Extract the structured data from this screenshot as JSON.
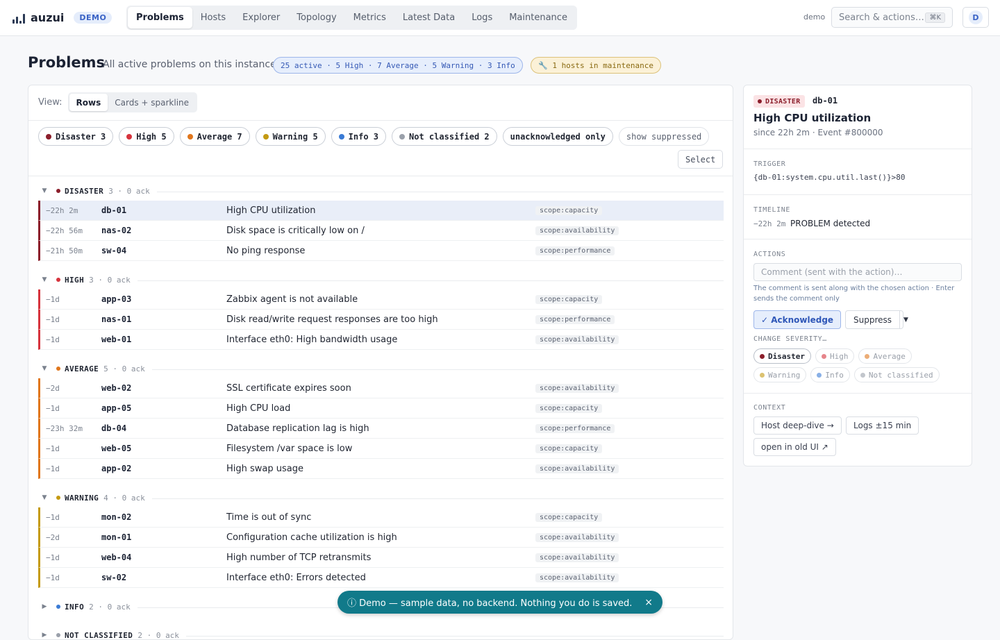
{
  "app": {
    "name": "auzui",
    "badge": "DEMO",
    "user": "demo",
    "avatar": "D"
  },
  "nav": {
    "items": [
      "Problems",
      "Hosts",
      "Explorer",
      "Topology",
      "Metrics",
      "Latest Data",
      "Logs",
      "Maintenance"
    ],
    "active": 0
  },
  "search": {
    "placeholder": "Search & actions…",
    "shortcut": "⌘K"
  },
  "page": {
    "title": "Problems",
    "subtitle": "All active problems on this instance",
    "summary": "25 active · 5 High · 7 Average · 5 Warning · 3 Info",
    "maintenance": "🔧 1 hosts in maintenance"
  },
  "view": {
    "label": "View:",
    "options": [
      "Rows",
      "Cards + sparkline"
    ],
    "active": 0
  },
  "filters": {
    "severity": [
      {
        "label": "Disaster 3",
        "color": "#8b1e2b"
      },
      {
        "label": "High 5",
        "color": "#d6333d"
      },
      {
        "label": "Average 7",
        "color": "#e0761c"
      },
      {
        "label": "Warning 5",
        "color": "#c49a12"
      },
      {
        "label": "Info 3",
        "color": "#3a7bd5"
      },
      {
        "label": "Not classified 2",
        "color": "#9aa0aa"
      }
    ],
    "unack": "unacknowledged only",
    "suppressed": "show suppressed",
    "select": "Select"
  },
  "groups": [
    {
      "name": "DISASTER",
      "count": "3 · 0 ack",
      "color": "#8b1e2b",
      "expanded": true,
      "rows": [
        {
          "age": "−22h 2m",
          "host": "db-01",
          "problem": "High CPU utilization",
          "tag": "scope:capacity",
          "selected": true
        },
        {
          "age": "−22h 56m",
          "host": "nas-02",
          "problem": "Disk space is critically low on /",
          "tag": "scope:availability"
        },
        {
          "age": "−21h 50m",
          "host": "sw-04",
          "problem": "No ping response",
          "tag": "scope:performance"
        }
      ]
    },
    {
      "name": "HIGH",
      "count": "3 · 0 ack",
      "color": "#d6333d",
      "expanded": true,
      "rows": [
        {
          "age": "−1d",
          "host": "app-03",
          "problem": "Zabbix agent is not available",
          "tag": "scope:capacity"
        },
        {
          "age": "−1d",
          "host": "nas-01",
          "problem": "Disk read/write request responses are too high",
          "tag": "scope:performance"
        },
        {
          "age": "−1d",
          "host": "web-01",
          "problem": "Interface eth0: High bandwidth usage",
          "tag": "scope:availability"
        }
      ]
    },
    {
      "name": "AVERAGE",
      "count": "5 · 0 ack",
      "color": "#e0761c",
      "expanded": true,
      "rows": [
        {
          "age": "−2d",
          "host": "web-02",
          "problem": "SSL certificate expires soon",
          "tag": "scope:availability"
        },
        {
          "age": "−1d",
          "host": "app-05",
          "problem": "High CPU load",
          "tag": "scope:capacity"
        },
        {
          "age": "−23h 32m",
          "host": "db-04",
          "problem": "Database replication lag is high",
          "tag": "scope:performance"
        },
        {
          "age": "−1d",
          "host": "web-05",
          "problem": "Filesystem /var space is low",
          "tag": "scope:capacity"
        },
        {
          "age": "−1d",
          "host": "app-02",
          "problem": "High swap usage",
          "tag": "scope:availability"
        }
      ]
    },
    {
      "name": "WARNING",
      "count": "4 · 0 ack",
      "color": "#c49a12",
      "expanded": true,
      "rows": [
        {
          "age": "−1d",
          "host": "mon-02",
          "problem": "Time is out of sync",
          "tag": "scope:capacity"
        },
        {
          "age": "−2d",
          "host": "mon-01",
          "problem": "Configuration cache utilization is high",
          "tag": "scope:availability"
        },
        {
          "age": "−1d",
          "host": "web-04",
          "problem": "High number of TCP retransmits",
          "tag": "scope:availability"
        },
        {
          "age": "−1d",
          "host": "sw-02",
          "problem": "Interface eth0: Errors detected",
          "tag": "scope:availability"
        }
      ]
    },
    {
      "name": "INFO",
      "count": "2 · 0 ack",
      "color": "#3a7bd5",
      "expanded": false,
      "rows": []
    },
    {
      "name": "NOT CLASSIFIED",
      "count": "2 · 0 ack",
      "color": "#9aa0aa",
      "expanded": false,
      "rows": []
    }
  ],
  "detail": {
    "severity": "DISASTER",
    "host": "db-01",
    "title": "High CPU utilization",
    "since": "since 22h 2m · Event #800000",
    "trigger_label": "TRIGGER",
    "trigger": "{db-01:system.cpu.util.last()}>80",
    "timeline_label": "TIMELINE",
    "timeline_age": "−22h 2m",
    "timeline_text": "PROBLEM detected",
    "actions_label": "ACTIONS",
    "comment_placeholder": "Comment (sent with the action)…",
    "hint": "The comment is sent along with the chosen action · Enter sends the comment only",
    "ack": "✓ Acknowledge",
    "suppress": "Suppress",
    "change_sev_label": "CHANGE SEVERITY…",
    "sev_options": [
      {
        "label": "Disaster",
        "color": "#8b1e2b",
        "active": true
      },
      {
        "label": "High",
        "color": "#d6333d"
      },
      {
        "label": "Average",
        "color": "#e0761c"
      },
      {
        "label": "Warning",
        "color": "#c49a12"
      },
      {
        "label": "Info",
        "color": "#3a7bd5"
      },
      {
        "label": "Not classified",
        "color": "#9aa0aa"
      }
    ],
    "context_label": "CONTEXT",
    "ctx_host": "Host deep-dive →",
    "ctx_logs": "Logs ±15 min",
    "ctx_old": "open in old UI ↗"
  },
  "toast": {
    "text": "ⓘ Demo — sample data, no backend. Nothing you do is saved.",
    "close": "×"
  }
}
